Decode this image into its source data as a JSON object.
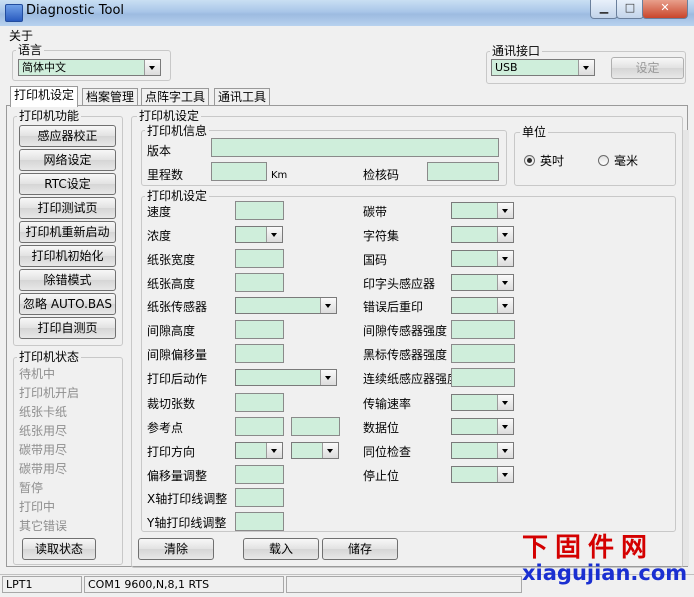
{
  "window": {
    "title": "Diagnostic Tool"
  },
  "menu": {
    "about": "关于"
  },
  "language": {
    "label": "语言",
    "value": "简体中文"
  },
  "comm": {
    "label": "通讯接口",
    "value": "USB",
    "set_button": "设定"
  },
  "tabs": [
    {
      "label": "打印机设定"
    },
    {
      "label": "档案管理"
    },
    {
      "label": "点阵字工具"
    },
    {
      "label": "通讯工具"
    }
  ],
  "functions": {
    "label": "打印机功能",
    "buttons": [
      "感应器校正",
      "网络设定",
      "RTC设定",
      "打印测试页",
      "打印机重新启动",
      "打印机初始化",
      "除错模式",
      "忽略 AUTO.BAS",
      "打印自测页"
    ]
  },
  "status": {
    "label": "打印机状态",
    "items": [
      "待机中",
      "打印机开启",
      "纸张卡纸",
      "纸张用尽",
      "碳带用尽",
      "碳带用尽",
      "暂停",
      "打印中",
      "其它错误"
    ],
    "read_button": "读取状态"
  },
  "printer_settings": {
    "label": "打印机设定"
  },
  "printer_info": {
    "label": "打印机信息",
    "version_label": "版本",
    "mileage_label": "里程数",
    "mileage_unit": "Km",
    "checksum_label": "检核码"
  },
  "units": {
    "label": "单位",
    "inch": "英吋",
    "mm": "毫米",
    "selected": "inch"
  },
  "settings": {
    "label": "打印机设定",
    "left": [
      "速度",
      "浓度",
      "纸张宽度",
      "纸张高度",
      "纸张传感器",
      "间隙高度",
      "间隙偏移量",
      "打印后动作",
      "裁切张数",
      "参考点",
      "打印方向",
      "偏移量调整",
      "X轴打印线调整",
      "Y轴打印线调整"
    ],
    "right": [
      "碳带",
      "字符集",
      "国码",
      "印字头感应器",
      "错误后重印",
      "间隙传感器强度",
      "黑标传感器强度",
      "连续纸感应器强度",
      "传输速率",
      "数据位",
      "同位检查",
      "停止位"
    ]
  },
  "actions": {
    "clear": "清除",
    "load": "载入",
    "save": "储存"
  },
  "statusbar": {
    "port": "LPT1",
    "com": "COM1 9600,N,8,1 RTS"
  },
  "watermark": {
    "cn": "下固件网",
    "en": "xiagujian.com"
  }
}
